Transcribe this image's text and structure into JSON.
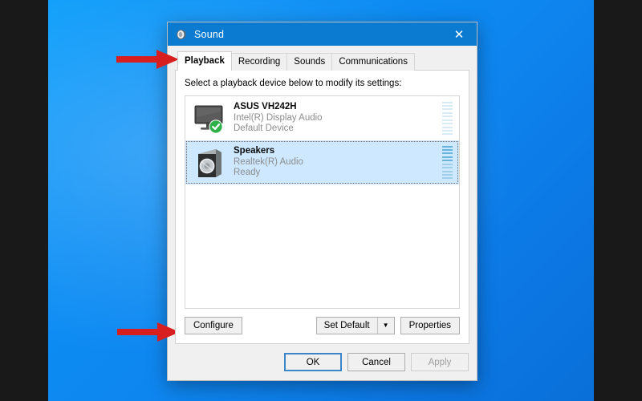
{
  "window": {
    "title": "Sound",
    "title_icon": "speaker-icon",
    "close_label": "✕",
    "titlebar_color": "#0b7ad1"
  },
  "tabs": [
    {
      "label": "Playback",
      "active": true
    },
    {
      "label": "Recording",
      "active": false
    },
    {
      "label": "Sounds",
      "active": false
    },
    {
      "label": "Communications",
      "active": false
    }
  ],
  "playback": {
    "instruction": "Select a playback device below to modify its settings:",
    "devices": [
      {
        "name": "ASUS VH242H",
        "driver": "Intel(R) Display Audio",
        "status": "Default Device",
        "icon": "monitor-icon",
        "badge": "green-check-badge",
        "selected": false,
        "meter_active": false
      },
      {
        "name": "Speakers",
        "driver": "Realtek(R) Audio",
        "status": "Ready",
        "icon": "speaker-box-icon",
        "badge": "",
        "selected": true,
        "meter_active": true
      }
    ],
    "buttons": {
      "configure": "Configure",
      "set_default": "Set Default",
      "set_default_arrow": "▼",
      "properties": "Properties"
    }
  },
  "footer": {
    "ok": "OK",
    "cancel": "Cancel",
    "apply": "Apply",
    "apply_disabled": true
  },
  "annotations": [
    {
      "name": "arrow-to-playback-tab",
      "direction": "right",
      "color": "#d81f1f"
    },
    {
      "name": "arrow-to-speakers-device",
      "direction": "left",
      "color": "#d81f1f"
    },
    {
      "name": "arrow-to-configure-button",
      "direction": "right",
      "color": "#d81f1f"
    }
  ]
}
